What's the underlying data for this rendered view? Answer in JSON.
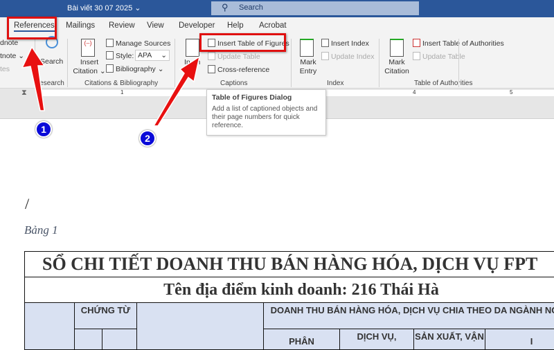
{
  "window": {
    "doc_title": "Bài viết 30 07 2025 ⌄",
    "search_placeholder": "Search"
  },
  "tabs": [
    "References",
    "Mailings",
    "Review",
    "View",
    "Developer",
    "Help",
    "Acrobat"
  ],
  "ribbon": {
    "footnotes": {
      "items": [
        "dnote",
        "tnote ⌄",
        "tes"
      ]
    },
    "research": {
      "button": "Search",
      "label": "Research"
    },
    "citations": {
      "insert_citation": "Insert Citation ⌄",
      "manage_sources": "Manage Sources",
      "style_label": "Style:",
      "style_value": "APA",
      "bibliography": "Bibliography ⌄",
      "label": "Citations & Bibliography"
    },
    "captions": {
      "insert_caption": "In  on",
      "insert_table_of_figures": "Insert Table of Figures",
      "update_table": "Update Table",
      "cross_reference": "Cross-reference",
      "label": "Captions"
    },
    "index": {
      "mark_entry": "Mark Entry",
      "insert_index": "Insert Index",
      "update_index": "Update Index",
      "label": "Index"
    },
    "authorities": {
      "mark_citation": "Mark Citation",
      "insert_toa": "Insert Table of Authorities",
      "update_table": "Update Table",
      "label": "Table of Authorities"
    }
  },
  "ruler": {
    "marks": [
      "1",
      "4",
      "5"
    ]
  },
  "tooltip": {
    "title": "Table of Figures Dialog",
    "body": "Add a list of captioned objects and their page numbers for quick reference."
  },
  "annotations": {
    "badge1": "1",
    "badge2": "2"
  },
  "document": {
    "slash": "/",
    "caption": "Bảng 1",
    "table": {
      "title": "SỔ CHI TIẾT DOANH THU BÁN HÀNG HÓA, DỊCH VỤ FPT",
      "location": "Tên địa điểm kinh doanh: 216 Thái Hà",
      "h_chung_tu": "CHỨNG TỪ",
      "h_doanh_thu": "DOANH THU BÁN HÀNG HÓA, DỊCH VỤ CHIA THEO DA NGÀNH NGHỀ",
      "h_sub": [
        "PHÂN",
        "DỊCH VỤ,",
        "SẢN XUẤT, VẬN",
        "I"
      ]
    }
  }
}
